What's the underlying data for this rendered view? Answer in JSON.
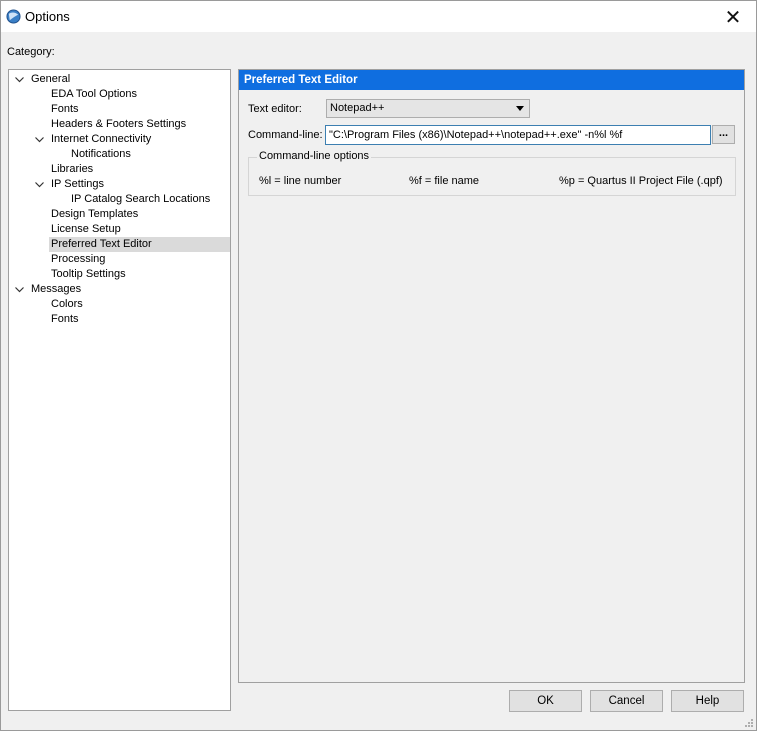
{
  "window": {
    "title": "Options",
    "close_glyph": "✕"
  },
  "category_label": "Category:",
  "tree": [
    {
      "label": "General",
      "level": 0,
      "expanded": true
    },
    {
      "label": "EDA Tool Options",
      "level": 1
    },
    {
      "label": "Fonts",
      "level": 1
    },
    {
      "label": "Headers & Footers Settings",
      "level": 1
    },
    {
      "label": "Internet Connectivity",
      "level": 1,
      "expanded": true
    },
    {
      "label": "Notifications",
      "level": 2
    },
    {
      "label": "Libraries",
      "level": 1
    },
    {
      "label": "IP Settings",
      "level": 1,
      "expanded": true
    },
    {
      "label": "IP Catalog Search Locations",
      "level": 2
    },
    {
      "label": "Design Templates",
      "level": 1
    },
    {
      "label": "License Setup",
      "level": 1
    },
    {
      "label": "Preferred Text Editor",
      "level": 1,
      "selected": true
    },
    {
      "label": "Processing",
      "level": 1
    },
    {
      "label": "Tooltip Settings",
      "level": 1
    },
    {
      "label": "Messages",
      "level": 0,
      "expanded": true
    },
    {
      "label": "Colors",
      "level": 1
    },
    {
      "label": "Fonts",
      "level": 1
    }
  ],
  "panel": {
    "title": "Preferred Text Editor",
    "text_editor_label": "Text editor:",
    "text_editor_value": "Notepad++",
    "command_line_label": "Command-line:",
    "command_line_value": "\"C:\\Program Files (x86)\\Notepad++\\notepad++.exe\" -n%l %f",
    "browse_label": "...",
    "options_group_title": "Command-line options",
    "options": [
      "%l = line number",
      "%f = file name",
      "%p = Quartus II Project File (.qpf)"
    ]
  },
  "buttons": {
    "ok": "OK",
    "cancel": "Cancel",
    "help": "Help"
  },
  "colors": {
    "header_blue": "#0f6ee0",
    "selection": "#dadada",
    "input_border": "#3c7fb1"
  }
}
